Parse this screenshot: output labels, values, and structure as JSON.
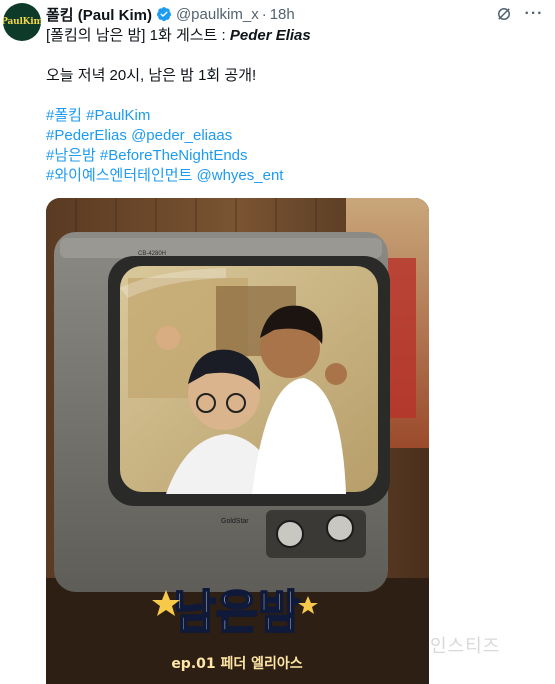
{
  "tweet": {
    "avatar_text": "PaulKim",
    "display_name": "폴킴 (Paul Kim)",
    "handle": "@paulkim_x",
    "separator": "·",
    "time": "18h",
    "line1_prefix": "[폴킴의 남은 밤] 1화 게스트 : ",
    "line1_guest": "Peder Elias",
    "line2": "오늘 저녁 20시, 남은 밤 1회 공개!",
    "hashtags": {
      "h1": "#폴킴",
      "h2": "#PaulKim",
      "h3": "#PederElias",
      "m1": "@peder_eliaas",
      "h4": "#남은밤",
      "h5": "#BeforeTheNightEnds",
      "h6": "#와이예스엔터테인먼트",
      "m2": "@whyes_ent"
    }
  },
  "media": {
    "tv_brand": "GoldStar",
    "tv_model": "CB-4280H",
    "poster_title": "남은밤",
    "poster_subtitle": "ep.01 페더 엘리아스"
  },
  "watermark": "인스티즈",
  "colors": {
    "link": "#1d9bf0",
    "verified": "#1d9bf0",
    "muted": "#536471"
  },
  "icons": [
    "verified-badge-icon",
    "grok-icon",
    "more-icon"
  ]
}
